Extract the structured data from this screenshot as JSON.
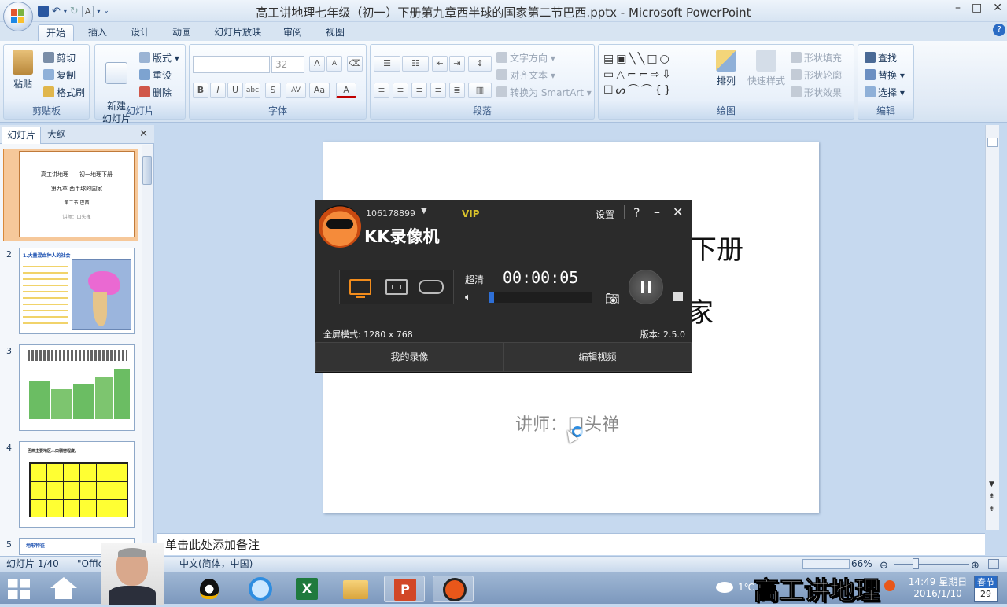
{
  "window": {
    "title": "高工讲地理七年级（初一）下册第九章西半球的国家第二节巴西.pptx - Microsoft PowerPoint",
    "controls": [
      "–",
      "□",
      "✕"
    ]
  },
  "ribbon": {
    "tabs": [
      "开始",
      "插入",
      "设计",
      "动画",
      "幻灯片放映",
      "审阅",
      "视图"
    ],
    "clipboard": {
      "label": "剪贴板",
      "paste": "粘贴",
      "cut": "剪切",
      "copy": "复制",
      "format_painter": "格式刷"
    },
    "slides": {
      "label": "幻灯片",
      "new_slide": "新建\n幻灯片",
      "layout": "版式",
      "reset": "重设",
      "delete": "删除"
    },
    "font": {
      "label": "字体",
      "size": "32",
      "bold": "B",
      "italic": "I",
      "underline": "U",
      "strike": "abc",
      "shadow": "S",
      "spacing": "AV",
      "case": "Aa",
      "color": "A",
      "grow": "A",
      "shrink": "A"
    },
    "paragraph": {
      "label": "段落",
      "text_direction": "文字方向",
      "align_text": "对齐文本",
      "smartart": "转换为 SmartArt"
    },
    "drawing": {
      "label": "绘图",
      "arrange": "排列",
      "quick_styles": "快速样式",
      "shape_fill": "形状填充",
      "shape_outline": "形状轮廓",
      "shape_effects": "形状效果"
    },
    "editing": {
      "label": "编辑",
      "find": "查找",
      "replace": "替换",
      "select": "选择"
    }
  },
  "panel": {
    "tabs": [
      "幻灯片",
      "大纲"
    ],
    "close": "✕",
    "slides": [
      {
        "num": "1",
        "lines": [
          "高工讲地理——初一地理下册",
          "第九章 西半球的国家",
          "第二节 巴西",
          "讲师：口头禅"
        ]
      },
      {
        "num": "2",
        "lines": [
          "1.大量混血种人的社会"
        ]
      },
      {
        "num": "3",
        "lines": []
      },
      {
        "num": "4",
        "lines": [
          "巴西主要地区人口稠密程度。"
        ]
      },
      {
        "num": "5",
        "lines": [
          "地形特征"
        ]
      }
    ]
  },
  "slide": {
    "title_line1": "理下册",
    "title_line2": "家",
    "lecturer": "讲师：口头禅"
  },
  "notes": {
    "placeholder": "单击此处添加备注"
  },
  "status": {
    "slide_info": "幻灯片 1/40",
    "theme": "\"Office",
    "lang": "中文(简体，中国)",
    "zoom": "66%"
  },
  "kk": {
    "user_id": "106178899",
    "vip": "VIP",
    "settings": "设置",
    "help": "?",
    "app_name": "KK录像机",
    "quality": "超清",
    "timer": "00:00:05",
    "mode_text": "全屏模式: 1280 x 768",
    "version": "版本: 2.5.0",
    "my_recordings": "我的录像",
    "edit_video": "编辑视频",
    "volume_level": 0.05
  },
  "taskbar": {
    "time": "14:49 星期日",
    "date": "2016/1/10",
    "calendar_label": "春节",
    "calendar_day": "29",
    "temp": "1℃",
    "watermark": "高工讲地理"
  }
}
